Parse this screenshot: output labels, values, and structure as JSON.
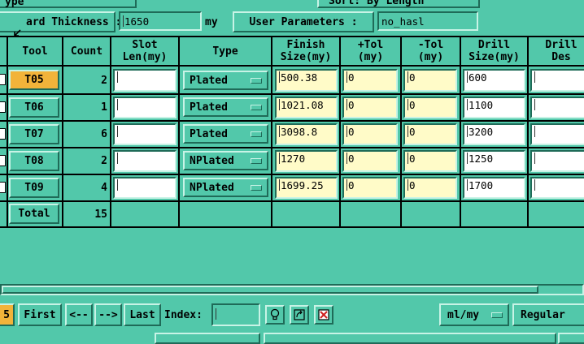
{
  "top": {
    "partial_left": "ype",
    "partial_right": "Sort: By Length",
    "thickness_label": "ard Thickness :",
    "thickness_value": "1650",
    "thickness_unit": "my",
    "user_params_label": "User Parameters :",
    "user_params_value": "no_hasl"
  },
  "table": {
    "headers": {
      "tool": "Tool",
      "count": "Count",
      "slot_len": "Slot\nLen(my)",
      "type": "Type",
      "finish": "Finish\nSize(my)",
      "plus_tol": "+Tol\n(my)",
      "minus_tol": "-Tol\n(my)",
      "drill_size": "Drill\nSize(my)",
      "drill_des": "Drill\nDes"
    },
    "rows": [
      {
        "tool": "T05",
        "count": "2",
        "type": "Plated",
        "finish": "500.38",
        "plus_tol": "0",
        "minus_tol": "0",
        "drill": "600"
      },
      {
        "tool": "T06",
        "count": "1",
        "type": "Plated",
        "finish": "1021.08",
        "plus_tol": "0",
        "minus_tol": "0",
        "drill": "1100"
      },
      {
        "tool": "T07",
        "count": "6",
        "type": "Plated",
        "finish": "3098.8",
        "plus_tol": "0",
        "minus_tol": "0",
        "drill": "3200"
      },
      {
        "tool": "T08",
        "count": "2",
        "type": "NPlated",
        "finish": "1270",
        "plus_tol": "0",
        "minus_tol": "0",
        "drill": "1250"
      },
      {
        "tool": "T09",
        "count": "4",
        "type": "NPlated",
        "finish": "1699.25",
        "plus_tol": "0",
        "minus_tol": "0",
        "drill": "1700"
      }
    ],
    "total_label": "Total",
    "total_count": "15"
  },
  "bottom": {
    "partial_btn": "5",
    "first": "First",
    "prev": "<--",
    "next": "-->",
    "last": "Last",
    "index_label": "Index:",
    "index_value": "",
    "units": "ml/my",
    "mode": "Regular"
  },
  "icons": {
    "bulb": "lightbulb-icon",
    "refresh": "refresh-icon",
    "delete": "delete-icon"
  },
  "colors": {
    "background": "#52c8aa",
    "field_yellow": "#fffbc8",
    "selected_tool": "#f2b33a"
  }
}
